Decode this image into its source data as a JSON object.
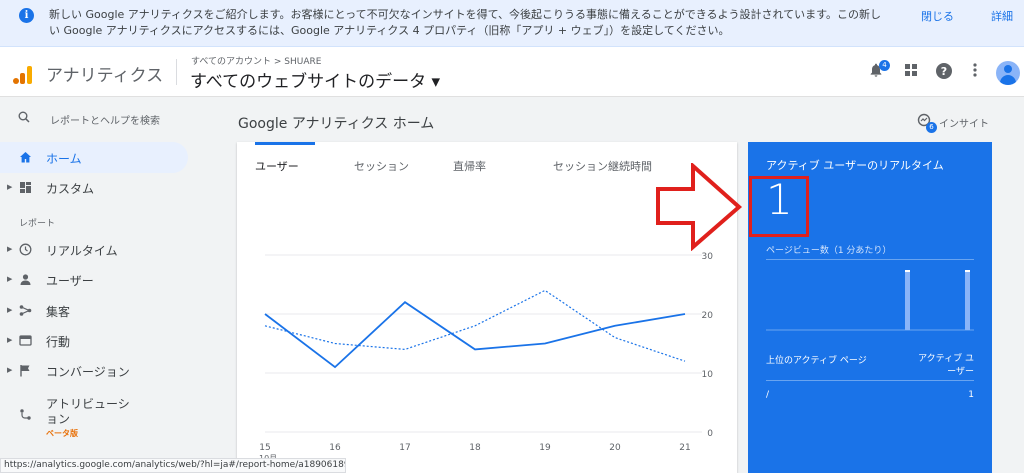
{
  "banner": {
    "message": "新しい Google アナリティクスをご紹介します。お客様にとって不可欠なインサイトを得て、今後起こりうる事態に備えることができるよう設計されています。この新しい Google アナリティクスにアクセスするには、Google アナリティクス 4 プロパティ（旧称「アプリ + ウェブ」）を設定してください。",
    "close_label": "閉じる",
    "detail_label": "詳細"
  },
  "header": {
    "app_name": "アナリティクス",
    "breadcrumb": "すべてのアカウント > SHUARE",
    "view_title": "すべてのウェブサイトのデータ ▾",
    "notification_count": "4",
    "logo_colors": [
      "#f9ab00",
      "#e37400",
      "#e37400"
    ]
  },
  "sidebar": {
    "search_placeholder": "レポートとヘルプを検索",
    "items": [
      {
        "label": "ホーム",
        "icon": "home-icon",
        "active": true
      },
      {
        "label": "カスタム",
        "icon": "dashboard-icon"
      },
      {
        "label": "リアルタイム",
        "icon": "clock-icon"
      },
      {
        "label": "ユーザー",
        "icon": "person-icon"
      },
      {
        "label": "集客",
        "icon": "acquisition-icon"
      },
      {
        "label": "行動",
        "icon": "behavior-icon"
      },
      {
        "label": "コンバージョン",
        "icon": "flag-icon"
      },
      {
        "label": "アトリビューション",
        "icon": "attribution-icon"
      }
    ],
    "section_label": "レポート",
    "beta_label": "ベータ版"
  },
  "main": {
    "page_title": "Google アナリティクス ホーム",
    "insight_label": "インサイト",
    "insight_count": "6",
    "tabs": [
      "ユーザー",
      "セッション",
      "直帰率",
      "セッション継続時間"
    ]
  },
  "chart_data": {
    "type": "line",
    "x": [
      "15",
      "16",
      "17",
      "18",
      "19",
      "20",
      "21"
    ],
    "x_sublabel": "10月",
    "ylim": [
      0,
      30
    ],
    "y_ticks": [
      "0",
      "10",
      "20",
      "30"
    ],
    "series": [
      {
        "values": [
          20,
          11,
          22,
          14,
          15,
          18,
          20
        ],
        "style": "solid",
        "color": "#1a73e8"
      },
      {
        "values": [
          18,
          15,
          14,
          18,
          24,
          16,
          12
        ],
        "style": "dashed",
        "color": "#1a73e8"
      }
    ],
    "grid": true
  },
  "realtime": {
    "title": "アクティブ ユーザーのリアルタイム",
    "active_users": "1",
    "pageviews_label": "ページビュー数（1 分あたり）",
    "top_pages_header": "上位のアクティブ ページ",
    "active_users_header": "アクティブ ユーザー",
    "rows": [
      {
        "page": "/",
        "users": "1"
      }
    ]
  },
  "status_url": "https://analytics.google.com/analytics/web/?hl=ja#/report-home/a189061891w26..."
}
